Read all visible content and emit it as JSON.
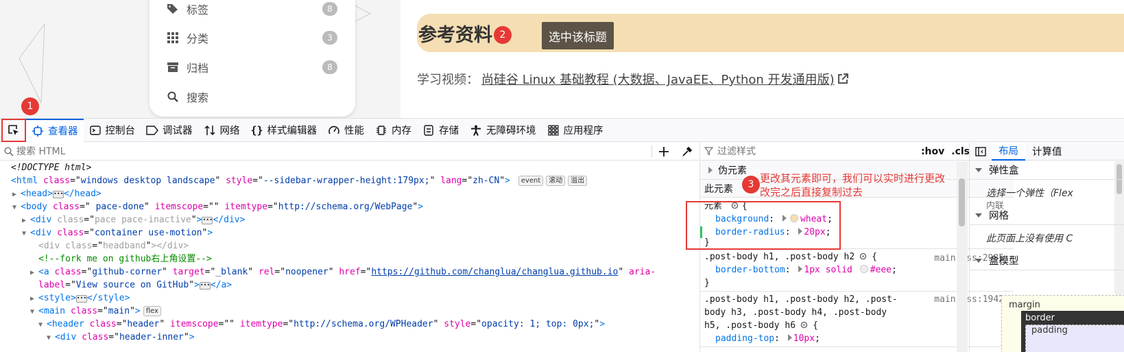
{
  "page": {
    "menu": [
      {
        "icon": "tags-icon",
        "label": "标签",
        "count": "8"
      },
      {
        "icon": "grid-icon",
        "label": "分类",
        "count": "3"
      },
      {
        "icon": "archive-icon",
        "label": "归档",
        "count": "8"
      },
      {
        "icon": "search-icon",
        "label": "搜索",
        "count": ""
      }
    ],
    "heading": "参考资料",
    "step2": "2",
    "tooltip": "选中该标题",
    "study_label": "学习视频：",
    "study_link": "尚硅谷 Linux 基础教程 (大数据、JavaEE、Python 开发通用版)",
    "heading_bg": "#f5deb3"
  },
  "devtools": {
    "step1": "1",
    "tabs": [
      {
        "icon": "inspector-icon",
        "label": "查看器",
        "active": true
      },
      {
        "icon": "console-icon",
        "label": "控制台"
      },
      {
        "icon": "debugger-icon",
        "label": "调试器"
      },
      {
        "icon": "network-icon",
        "label": "网络"
      },
      {
        "icon": "style-editor-icon",
        "label": "样式编辑器"
      },
      {
        "icon": "performance-icon",
        "label": "性能"
      },
      {
        "icon": "memory-icon",
        "label": "内存"
      },
      {
        "icon": "storage-icon",
        "label": "存储"
      },
      {
        "icon": "accessibility-icon",
        "label": "无障碍环境"
      },
      {
        "icon": "application-icon",
        "label": "应用程序"
      }
    ],
    "search_placeholder": "搜索 HTML",
    "tree": {
      "doctype": "<!DOCTYPE html>",
      "html_class": "windows desktop landscape",
      "html_style": "--sidebar-wrapper-height:179px;",
      "html_lang": "zh-CN",
      "pills": [
        "event",
        "滚动",
        "溢出"
      ],
      "body_class": " pace-done",
      "body_itemscope": "",
      "body_itemtype": "http://schema.org/WebPage",
      "div_pace_class": "pace pace-inactive",
      "div_container_class": "container use-motion",
      "div_headband_class": "headband",
      "comment": "<!--fork me on github右上角设置-->",
      "a_class": "github-corner",
      "a_target": "_blank",
      "a_rel": "noopener",
      "a_href": "https://github.com/changlua/changlua.github.io",
      "a_aria_label": "View source on GitHub",
      "main_class": "main",
      "flex_pill": "flex",
      "header_class": "header",
      "header_itemscope": "",
      "header_itemtype": "http://schema.org/WPHeader",
      "header_style": "opacity: 1; top: 0px;",
      "header_inner": "header-inner"
    },
    "rules": {
      "filter_placeholder": "过滤样式",
      "hov": ":hov",
      "cls": ".cls",
      "pseudo": "伪元素",
      "this_element": "此元素",
      "element_label": "元素",
      "inline_label": "内联",
      "bg_prop": "background",
      "bg_val": "wheat",
      "br_prop": "border-radius",
      "br_val": "20px",
      "rule2_selector": ".post-body h1, .post-body h2",
      "rule2_src": "main.css:2985",
      "rule2_prop": "border-bottom",
      "rule2_val_a": "1px solid",
      "rule2_val_b": "#eee",
      "rule3_selector_a": ".post-body h1, .post-body h2, .post-",
      "rule3_selector_b": "body h3, .post-body h4, .post-body",
      "rule3_selector_c": "h5, .post-body h6",
      "rule3_src": "main.css:1942",
      "rule3_prop": "padding-top",
      "rule3_val": "10px",
      "step3": "3",
      "note_line1": "更改其元素即可，我们可以实时进行更改",
      "note_line2": "改完之后直接复制过去"
    },
    "layout": {
      "tabs": [
        "布局",
        "计算值"
      ],
      "flexbox": "弹性盒",
      "flexbox_body": "选择一个弹性（Flex",
      "grid": "网格",
      "grid_body": "此页面上没有使用 C",
      "boxmodel": "盒模型",
      "margin": "margin",
      "border": "border",
      "padding": "padding"
    }
  }
}
